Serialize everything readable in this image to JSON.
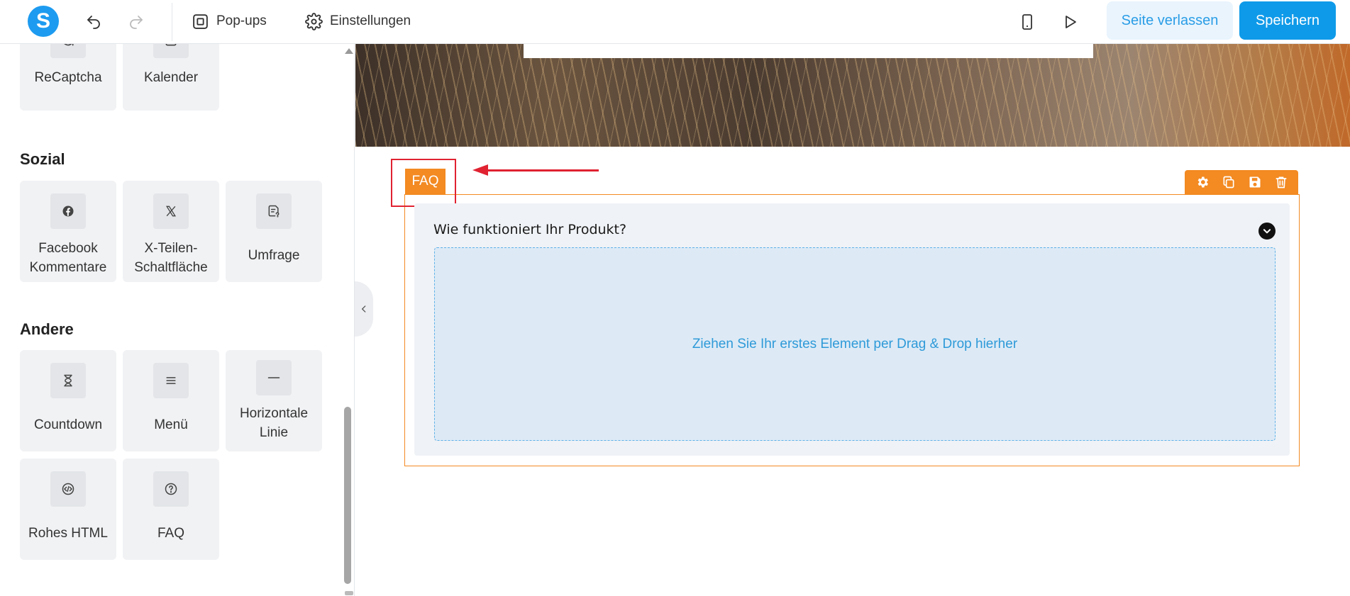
{
  "toolbar": {
    "logo_letter": "S",
    "popups_label": "Pop-ups",
    "settings_label": "Einstellungen",
    "leave_label": "Seite verlassen",
    "save_label": "Speichern"
  },
  "sidebar": {
    "top_items": [
      {
        "label": "ReCaptcha",
        "icon": "refresh-icon"
      },
      {
        "label": "Kalender",
        "icon": "calendar-icon"
      }
    ],
    "sections": [
      {
        "title": "Sozial",
        "items": [
          {
            "label": "Facebook\nKommentare",
            "icon": "facebook-icon"
          },
          {
            "label": "X-Teilen-\nSchaltfläche",
            "icon": "x-logo-icon"
          },
          {
            "label": "Umfrage",
            "icon": "survey-icon"
          }
        ]
      },
      {
        "title": "Andere",
        "items": [
          {
            "label": "Countdown",
            "icon": "hourglass-icon"
          },
          {
            "label": "Menü",
            "icon": "menu-icon"
          },
          {
            "label": "Horizontale\nLinie",
            "icon": "horizontal-line-icon"
          },
          {
            "label": "Rohes HTML",
            "icon": "code-icon"
          },
          {
            "label": "FAQ",
            "icon": "question-icon"
          }
        ]
      }
    ]
  },
  "canvas": {
    "element_tag": "FAQ",
    "faq_question": "Wie funktioniert Ihr Produkt?",
    "dropzone_text": "Ziehen Sie Ihr erstes Element per Drag & Drop hierher"
  },
  "colors": {
    "brand": "#1d9bf0",
    "accent_orange": "#f38a22",
    "annotation_red": "#e02231"
  }
}
